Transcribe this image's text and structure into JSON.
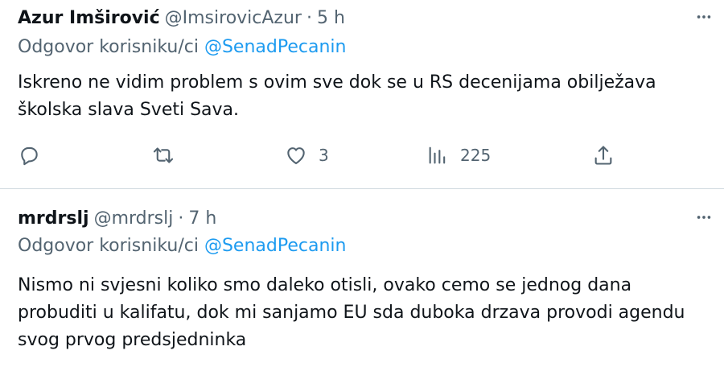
{
  "tweets": [
    {
      "name": "Azur Imširović",
      "handle": "@ImsirovicAzur",
      "separator": "·",
      "time": "5 h",
      "replying_prefix": "Odgovor korisniku/ci",
      "replying_to": "@SenadPecanin",
      "text": "Iskreno ne vidim problem s ovim sve dok se u RS decenijama obilježava školska slava Sveti Sava.",
      "likes": "3",
      "views": "225"
    },
    {
      "name": "mrdrslj",
      "handle": "@mrdrslj",
      "separator": "·",
      "time": "7 h",
      "replying_prefix": "Odgovor korisniku/ci",
      "replying_to": "@SenadPecanin",
      "text": "Nismo ni svjesni koliko smo daleko otisli, ovako cemo se jednog dana probuditi u kalifatu, dok mi sanjamo EU sda duboka drzava provodi agendu svog prvog predsjedninka"
    }
  ],
  "icons": {
    "more": "more-horizontal-icon",
    "reply": "reply-icon",
    "retweet": "retweet-icon",
    "like": "heart-icon",
    "views": "views-icon",
    "share": "share-icon"
  },
  "colors": {
    "text": "#0f1419",
    "secondary": "#536471",
    "link": "#1d9bf0",
    "divider": "#cfd9de"
  }
}
